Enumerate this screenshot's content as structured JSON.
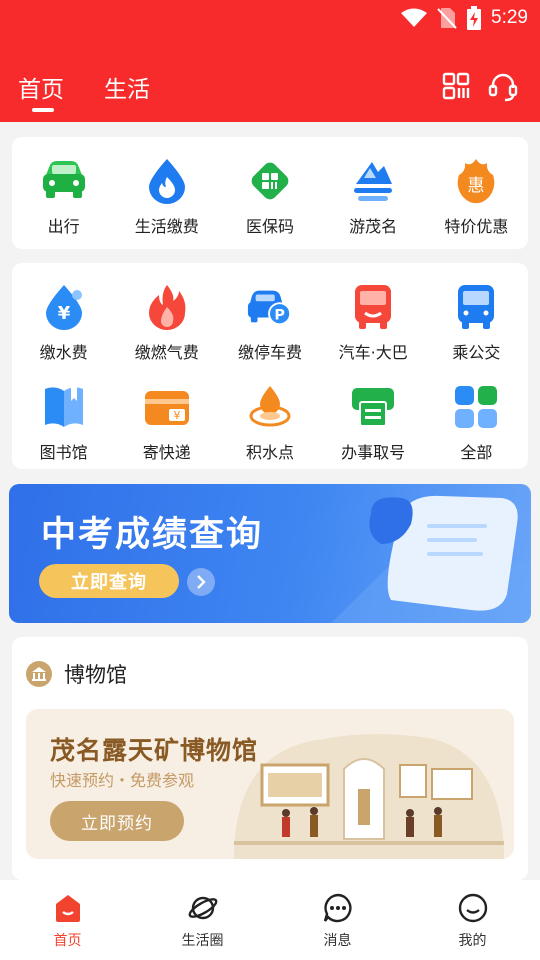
{
  "status": {
    "time": "5:29"
  },
  "header": {
    "tabs": [
      {
        "label": "首页"
      },
      {
        "label": "生活"
      }
    ]
  },
  "top_services": [
    {
      "label": "出行",
      "icon": "car-icon"
    },
    {
      "label": "生活缴费",
      "icon": "water-drop-flame-icon"
    },
    {
      "label": "医保码",
      "icon": "medical-code-icon"
    },
    {
      "label": "游茂名",
      "icon": "mountain-icon"
    },
    {
      "label": "特价优惠",
      "icon": "discount-icon"
    }
  ],
  "services": [
    {
      "label": "缴水费",
      "icon": "water-fee-icon"
    },
    {
      "label": "缴燃气费",
      "icon": "gas-fee-icon"
    },
    {
      "label": "缴停车费",
      "icon": "parking-fee-icon"
    },
    {
      "label": "汽车·大巴",
      "icon": "coach-bus-icon"
    },
    {
      "label": "乘公交",
      "icon": "city-bus-icon"
    },
    {
      "label": "图书馆",
      "icon": "library-icon"
    },
    {
      "label": "寄快递",
      "icon": "express-delivery-icon"
    },
    {
      "label": "积水点",
      "icon": "waterlogging-icon"
    },
    {
      "label": "办事取号",
      "icon": "queue-ticket-icon"
    },
    {
      "label": "全部",
      "icon": "all-apps-icon"
    }
  ],
  "banner": {
    "title": "中考成绩查询",
    "button": "立即查询"
  },
  "museum": {
    "section_title": "博物馆",
    "promo_title": "茂名露天矿博物馆",
    "promo_sub": "快速预约・免费参观",
    "promo_button": "立即预约"
  },
  "bottom_nav": [
    {
      "label": "首页",
      "icon": "home-icon"
    },
    {
      "label": "生活圈",
      "icon": "planet-icon"
    },
    {
      "label": "消息",
      "icon": "message-icon"
    },
    {
      "label": "我的",
      "icon": "profile-icon"
    }
  ],
  "colors": {
    "header": "#f72b2b",
    "accent": "#f2432f",
    "banner": "#3f86f2",
    "museum_brown": "#8a5a25"
  }
}
